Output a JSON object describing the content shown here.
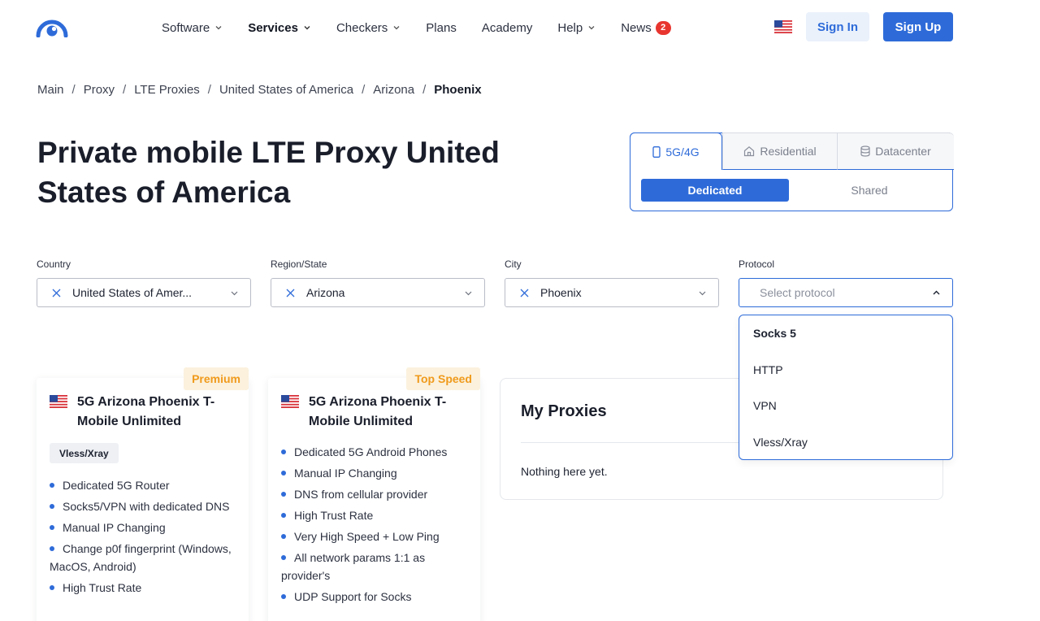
{
  "colors": {
    "accent": "#2e6bd9",
    "badge": "#e8362f",
    "tag_text": "#f09a1c",
    "tag_bg": "#fbf1dd"
  },
  "header": {
    "nav": [
      {
        "label": "Software",
        "dropdown": true
      },
      {
        "label": "Services",
        "dropdown": true,
        "active": true
      },
      {
        "label": "Checkers",
        "dropdown": true
      },
      {
        "label": "Plans",
        "dropdown": false
      },
      {
        "label": "Academy",
        "dropdown": false
      },
      {
        "label": "Help",
        "dropdown": true
      },
      {
        "label": "News",
        "dropdown": false,
        "badge": "2"
      }
    ],
    "language_icon": "us-flag-icon",
    "sign_in": "Sign In",
    "sign_up": "Sign Up"
  },
  "breadcrumb": [
    "Main",
    "Proxy",
    "LTE Proxies",
    "United States of America",
    "Arizona",
    "Phoenix"
  ],
  "page_title": "Private mobile LTE Proxy United States of America",
  "proxy_type": {
    "tabs": [
      {
        "label": "5G/4G",
        "icon": "phone-icon",
        "selected": true
      },
      {
        "label": "Residential",
        "icon": "house-icon",
        "selected": false
      },
      {
        "label": "Datacenter",
        "icon": "database-icon",
        "selected": false
      }
    ],
    "subtabs": [
      {
        "label": "Dedicated",
        "selected": true
      },
      {
        "label": "Shared",
        "selected": false
      }
    ]
  },
  "filters": {
    "country": {
      "label": "Country",
      "value": "United States of Amer..."
    },
    "region": {
      "label": "Region/State",
      "value": "Arizona"
    },
    "city": {
      "label": "City",
      "value": "Phoenix"
    },
    "protocol": {
      "label": "Protocol",
      "placeholder": "Select protocol",
      "options": [
        "Socks 5",
        "HTTP",
        "VPN",
        "Vless/Xray"
      ]
    }
  },
  "cards": [
    {
      "tag": "Premium",
      "title": "5G Arizona Phoenix T-Mobile Unlimited",
      "pill": "Vless/Xray",
      "features": [
        "Dedicated 5G Router",
        "Socks5/VPN with dedicated DNS",
        "Manual IP Changing",
        "Change p0f fingerprint (Windows, MacOS, Android)",
        "High Trust Rate"
      ]
    },
    {
      "tag": "Top Speed",
      "title": "5G Arizona Phoenix T-Mobile Unlimited",
      "features": [
        "Dedicated 5G Android Phones",
        "Manual IP Changing",
        "DNS from cellular provider",
        "High Trust Rate",
        "Very High Speed + Low Ping",
        "All network params 1:1 as provider's",
        "UDP Support for Socks"
      ]
    }
  ],
  "my_proxies": {
    "title": "My Proxies",
    "empty": "Nothing here yet."
  }
}
